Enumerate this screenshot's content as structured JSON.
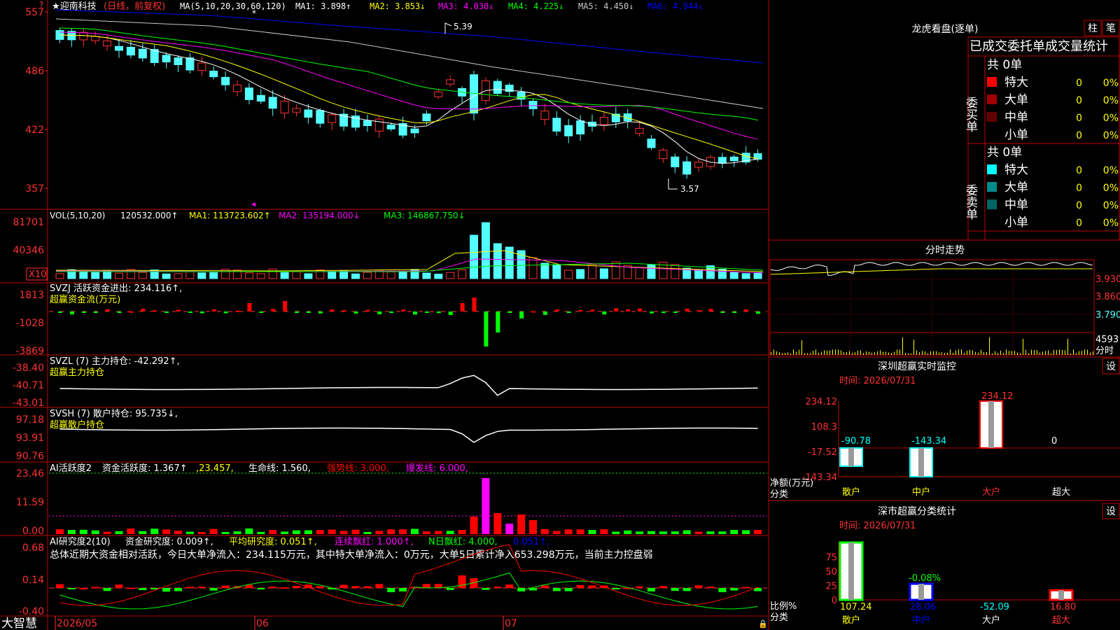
{
  "app": {
    "brand": "大智慧",
    "lock_glyph": "🔒"
  },
  "colors": {
    "bg": "#000000",
    "grid": "#8b0000",
    "border": "#c00000",
    "axis_text": "#ff3232",
    "up": "#ff3232",
    "down": "#54ffff",
    "ma1": "#ffffff",
    "ma2": "#ffff00",
    "ma3": "#ff00ff",
    "ma4": "#00ff00",
    "ma5": "#c8c8c8",
    "ma6": "#0000ff",
    "pos_bar": "#ff0000",
    "neg_bar": "#00ff00",
    "label_yellow": "#ffff00",
    "label_white": "#ffffff"
  },
  "stock": {
    "name": "★迎南科技",
    "period": "(日线，前复权)"
  },
  "main_panel": {
    "ma_header": "MA(5,10,20,30,60,120)",
    "ma1": "MA1: 3.898↑",
    "ma2": "MA2: 3.853↓",
    "ma3": "MA3: 4.030↓",
    "ma4": "MA4: 4.225↓",
    "ma5": "MA5: 4.450↓",
    "ma6": "MA6: 4.944↓",
    "high_marker": "5.39",
    "low_marker": "3.57",
    "y_ticks": [
      "557",
      "486",
      "422",
      "357"
    ]
  },
  "vol_panel": {
    "label": "VOL(5,10,20)",
    "value": "120532.000↑",
    "ma1": "MA1: 113723.602↑",
    "ma2": "MA2: 135194.000↓",
    "ma3": "MA3: 146867.750↓",
    "y_ticks": [
      "81701",
      "40346"
    ],
    "multiplier": "X10"
  },
  "svzj_panel": {
    "title": "SVZJ  活跃资金进出: 234.116↑,",
    "subtitle": "超赢资金流(万元)",
    "y_ticks": [
      "1813",
      "-1028",
      "-3869"
    ]
  },
  "svzl_panel": {
    "title": "SVZL (7) 主力持仓: -42.292↑,",
    "subtitle": "超赢主力持仓",
    "y_ticks": [
      "-38.40",
      "-40.71",
      "-43.01"
    ]
  },
  "svsh_panel": {
    "title": "SVSH (7) 散户持仓: 95.735↓,",
    "subtitle": "超赢散户持仓",
    "y_ticks": [
      "97.18",
      "93.91",
      "90.76"
    ]
  },
  "ai2_panel": {
    "title": "AI活跃度2",
    "a": "资金活跃度: 1.367↑",
    "b": ",23.457,",
    "c": "生命线: 1.560,",
    "d": "强势线: 3.000,",
    "e": "爆发线: 6.000,",
    "y_ticks": [
      "23.46",
      "11.59",
      "0.00"
    ]
  },
  "ai_research_panel": {
    "title": "AI研究度2(10)",
    "a": "资金研究度: 0.009↑,",
    "b": "平均研究度: 0.051↑,",
    "c": "连续飘红: 1.000↑,",
    "d": "N日飘红: 4.000,",
    "e": "0.051↑,",
    "summary": "总体近期大资金相对活跃，今日大单净流入：234.115万元，其中特大单净流入：0万元，大单5日累计净入653.298万元，当前主力控盘弱",
    "y_ticks": [
      "0.68",
      "0.14",
      "-0.40"
    ]
  },
  "x_axis": [
    "2026/05",
    "06",
    "07"
  ],
  "dragon": {
    "title": "龙虎看盘(逐单)",
    "btn_bar": "柱",
    "btn_pen": "笔",
    "subtitle": "已成交委托单成交量统计",
    "buy_label": "委买单",
    "sell_label": "委卖单",
    "buy_total": "共 0单",
    "sell_total": "共 0单",
    "buy_rows": [
      {
        "label": "特大",
        "count": "0",
        "pct": "0%",
        "color": "#ff0000"
      },
      {
        "label": "大单",
        "count": "0",
        "pct": "0%",
        "color": "#a00000"
      },
      {
        "label": "中单",
        "count": "0",
        "pct": "0%",
        "color": "#640000"
      },
      {
        "label": "小单",
        "count": "0",
        "pct": "0%",
        "color": "#000000"
      }
    ],
    "sell_rows": [
      {
        "label": "特大",
        "count": "0",
        "pct": "0%",
        "color": "#00ffff"
      },
      {
        "label": "大单",
        "count": "0",
        "pct": "0%",
        "color": "#008b8b"
      },
      {
        "label": "中单",
        "count": "0",
        "pct": "0%",
        "color": "#006464"
      },
      {
        "label": "小单",
        "count": "0",
        "pct": "0%",
        "color": "#000000"
      }
    ]
  },
  "intraday": {
    "title": "分时走势",
    "prices": [
      "3.930",
      "3.860",
      "3.790"
    ],
    "vol_label": "4593",
    "vol_unit": "分时"
  },
  "monitor": {
    "title": "深圳超赢实时监控",
    "btn": "设",
    "time": "时间: 2026/07/31",
    "y_ticks": [
      "234.12",
      "108.3",
      "-17.52",
      "-143.34"
    ],
    "unit_label": "净额(万元)",
    "cat_label": "分类",
    "chart_data": {
      "type": "bar",
      "categories": [
        "散户",
        "中户",
        "大户",
        "超大"
      ],
      "values": [
        -90.78,
        -143.34,
        234.12,
        0
      ],
      "value_labels": [
        "-90.78",
        "-143.34",
        "234.12",
        "0"
      ],
      "ylim": [
        -143.34,
        234.12
      ]
    }
  },
  "classify": {
    "title": "深市超赢分类统计",
    "btn": "设",
    "time": "时间: 2026/07/31",
    "y_ticks": [
      "75",
      "50",
      "25",
      "0"
    ],
    "unit_label": "比例%",
    "cat_label": "分类",
    "chart_data": {
      "type": "bar",
      "categories": [
        "散户",
        "中户",
        "大户",
        "超大"
      ],
      "bar_heights": [
        107.24,
        28.06,
        0,
        16.8
      ],
      "values": [
        "107.24",
        "28.06",
        "-52.09",
        "16.80"
      ],
      "annotation": "-0.08%",
      "ylim": [
        0,
        100
      ]
    }
  }
}
